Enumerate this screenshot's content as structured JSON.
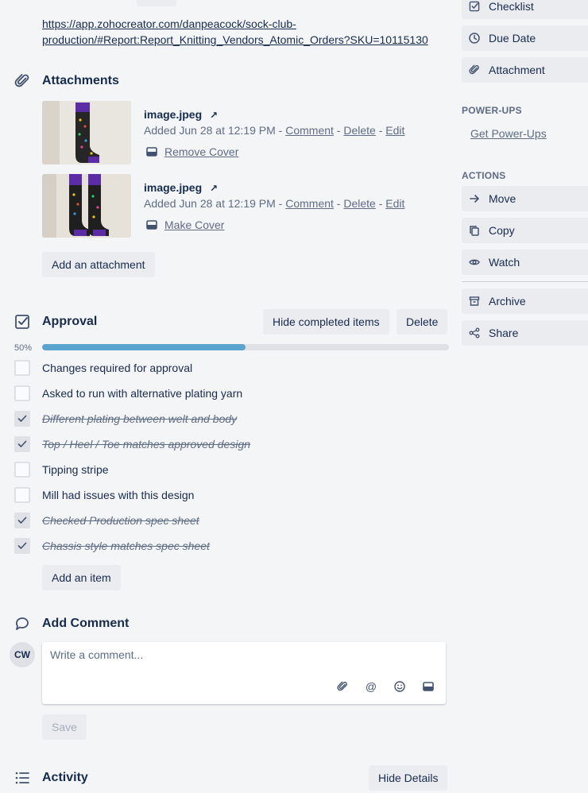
{
  "description": {
    "link": "https://app.zohocreator.com/danpeacock/sock-club-production/#Report:Report_Knitting_Vendors_Atomic_Orders?SKU=10115130",
    "link_line1": "https://app.zohocreator.com/danpeacock/sock-club-",
    "link_line2": "production/#Report:Report_Knitting_Vendors_Atomic_Orders?SKU=10115130"
  },
  "attachments": {
    "title": "Attachments",
    "items": [
      {
        "name": "image.jpeg",
        "added": "Added Jun 28 at 12:19 PM - ",
        "comment": "Comment",
        "delete": "Delete",
        "edit": "Edit",
        "sep": " - ",
        "cover_action": "Remove Cover"
      },
      {
        "name": "image.jpeg",
        "added": "Added Jun 28 at 12:19 PM - ",
        "comment": "Comment",
        "delete": "Delete",
        "edit": "Edit",
        "sep": " - ",
        "cover_action": "Make Cover"
      }
    ],
    "add_button": "Add an attachment"
  },
  "checklist": {
    "title": "Approval",
    "hide_completed": "Hide completed items",
    "delete": "Delete",
    "progress_label": "50%",
    "progress": 0.5,
    "items": [
      {
        "text": "Changes required for approval",
        "checked": false
      },
      {
        "text": "Asked to run with alternative plating yarn",
        "checked": false
      },
      {
        "text": "Different plating between welt and body",
        "checked": true
      },
      {
        "text": "Top / Heel / Toe matches approved design",
        "checked": true
      },
      {
        "text": "Tipping stripe",
        "checked": false
      },
      {
        "text": "Mill had issues with this design",
        "checked": false
      },
      {
        "text": "Checked Production spec sheet",
        "checked": true
      },
      {
        "text": "Chassis style matches spec sheet",
        "checked": true
      }
    ],
    "add_item": "Add an item"
  },
  "comment": {
    "title": "Add Comment",
    "avatar_initials": "CW",
    "placeholder": "Write a comment...",
    "save": "Save"
  },
  "activity": {
    "title": "Activity",
    "hide_details": "Hide Details"
  },
  "sidebar": {
    "add_items": [
      {
        "label": "Checklist",
        "icon": "checklist-icon"
      },
      {
        "label": "Due Date",
        "icon": "clock-icon"
      },
      {
        "label": "Attachment",
        "icon": "paperclip-icon"
      }
    ],
    "powerups_heading": "POWER-UPS",
    "get_powerups": "Get Power-Ups",
    "actions_heading": "ACTIONS",
    "actions": [
      {
        "label": "Move",
        "icon": "arrow-right-icon"
      },
      {
        "label": "Copy",
        "icon": "copy-icon"
      },
      {
        "label": "Watch",
        "icon": "eye-icon"
      }
    ],
    "more_actions": [
      {
        "label": "Archive",
        "icon": "archive-icon"
      },
      {
        "label": "Share",
        "icon": "share-icon"
      }
    ]
  },
  "colors": {
    "background": "#f4f5f7",
    "button": "#ebecf0",
    "progress_fill": "#5ba4cf",
    "text": "#172b4d",
    "muted": "#5e6c84"
  }
}
